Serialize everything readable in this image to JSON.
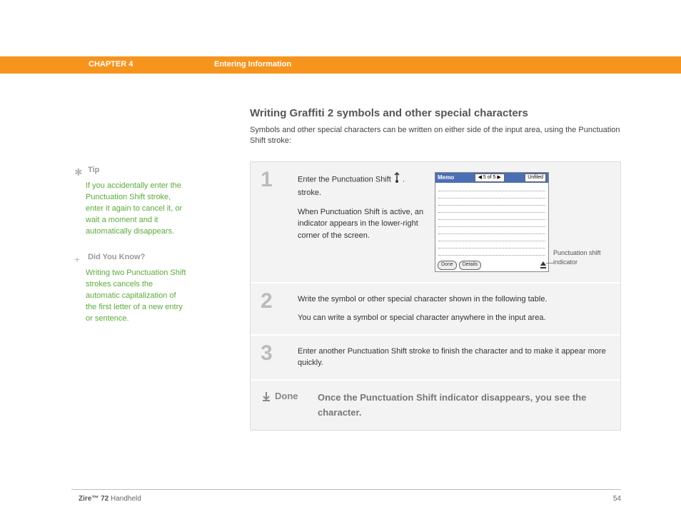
{
  "header": {
    "chapter": "CHAPTER 4",
    "title": "Entering Information"
  },
  "sidebar": {
    "tip": {
      "head": "Tip",
      "body": "If you accidentally enter the Punctuation Shift stroke, enter it again to cancel it, or wait a moment and it automatically disappears."
    },
    "dyk": {
      "head": "Did You Know?",
      "body": "Writing two Punctuation Shift strokes cancels the automatic capitalization of the first letter of a new entry or sentence."
    }
  },
  "main": {
    "title": "Writing Graffiti 2 symbols and other special characters",
    "intro": "Symbols and other special characters can be written on either side of the input area, using the Punctuation Shift stroke:",
    "step1": {
      "num": "1",
      "p1a": "Enter the Punctuation Shift ",
      "p1b": ". stroke.",
      "p2": "When Punctuation Shift is active, an indicator appears in the lower-right corner of the screen.",
      "callout": "Punctuation shift indicator",
      "pda": {
        "memo": "Memo",
        "nav": "◀ 5 of 5 ▶",
        "unfiled": "Unfiled",
        "done": "Done",
        "details": "Details"
      }
    },
    "step2": {
      "num": "2",
      "p1": "Write the symbol or other special character shown in the following table.",
      "p2": "You can write a symbol or special character anywhere in the input area."
    },
    "step3": {
      "num": "3",
      "p1": "Enter another Punctuation Shift stroke to finish the character and to make it appear more quickly."
    },
    "done": {
      "label": "Done",
      "text": "Once the Punctuation Shift indicator disappears, you see the character."
    }
  },
  "footer": {
    "product": "Zire™ 72",
    "label": " Handheld",
    "page": "54"
  }
}
